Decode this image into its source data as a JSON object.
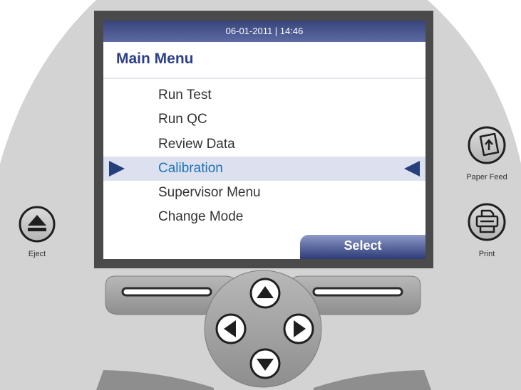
{
  "screen": {
    "datetime": "06-01-2011 | 14:46",
    "title": "Main Menu",
    "menu": [
      {
        "label": "Run Test",
        "selected": false
      },
      {
        "label": "Run QC",
        "selected": false
      },
      {
        "label": "Review Data",
        "selected": false
      },
      {
        "label": "Calibration",
        "selected": true
      },
      {
        "label": "Supervisor Menu",
        "selected": false
      },
      {
        "label": "Change Mode",
        "selected": false
      }
    ],
    "softkey_right": "Select"
  },
  "buttons": {
    "eject": "Eject",
    "paper_feed": "Paper Feed",
    "print": "Print"
  },
  "icons": {
    "eject": "eject-icon",
    "paper_feed": "paper-feed-icon",
    "print": "printer-icon",
    "nav_up": "triangle-up-icon",
    "nav_down": "triangle-down-icon",
    "nav_left": "triangle-left-icon",
    "nav_right": "triangle-right-icon"
  },
  "colors": {
    "panel": "#d3d3d3",
    "header_bar": "#4b5791",
    "title": "#2c3f8c",
    "selected_bg": "#dde1ef",
    "selected_text": "#1c73b5",
    "selection_arrow": "#25407a"
  }
}
